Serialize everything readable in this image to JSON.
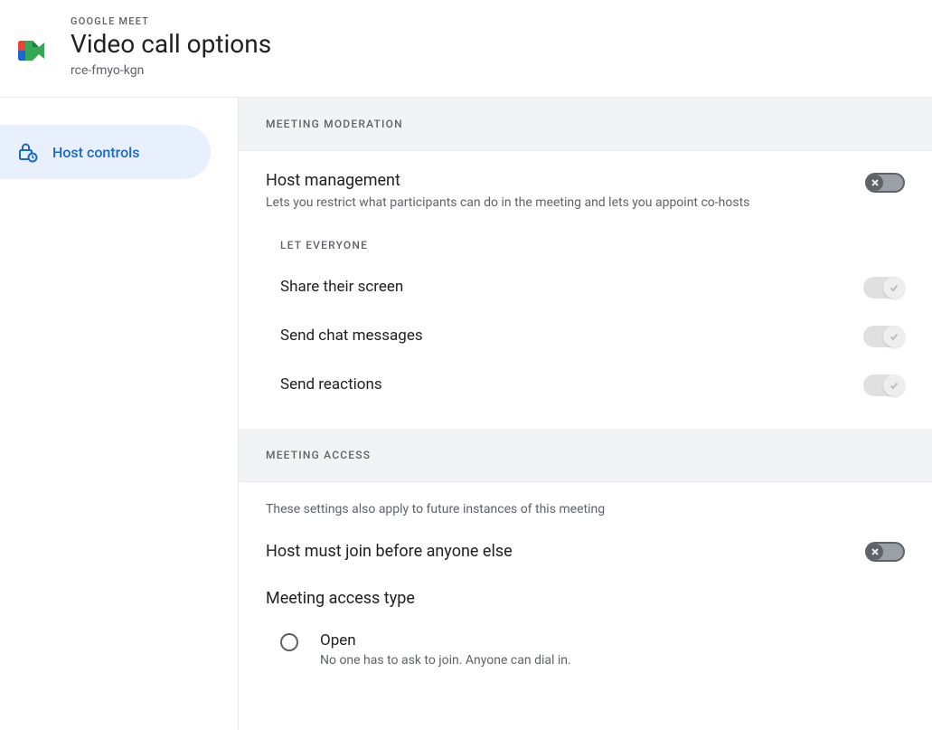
{
  "header": {
    "app_name": "GOOGLE MEET",
    "title": "Video call options",
    "meeting_id": "rce-fmyo-kgn"
  },
  "sidebar": {
    "items": [
      {
        "label": "Host controls"
      }
    ]
  },
  "sections": {
    "moderation": {
      "header": "MEETING MODERATION",
      "host_management": {
        "title": "Host management",
        "desc": "Lets you restrict what participants can do in the meeting and lets you appoint co-hosts",
        "enabled": false
      },
      "let_everyone_label": "LET EVERYONE",
      "permissions": [
        {
          "label": "Share their screen",
          "enabled": true
        },
        {
          "label": "Send chat messages",
          "enabled": true
        },
        {
          "label": "Send reactions",
          "enabled": true
        }
      ]
    },
    "access": {
      "header": "MEETING ACCESS",
      "info": "These settings also apply to future instances of this meeting",
      "host_must_join": {
        "title": "Host must join before anyone else",
        "enabled": false
      },
      "access_type": {
        "title": "Meeting access type",
        "options": [
          {
            "label": "Open",
            "desc": "No one has to ask to join. Anyone can dial in.",
            "selected": false
          }
        ]
      }
    }
  }
}
